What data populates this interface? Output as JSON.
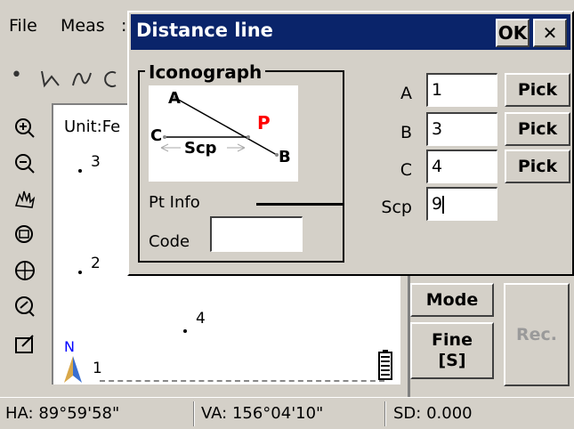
{
  "menubar": {
    "items": [
      "File",
      "Meas",
      ":"
    ]
  },
  "toolbar": {
    "glyphs": [
      "•",
      "⅃ᔑ",
      "ᔑ",
      "ᑕ"
    ]
  },
  "canvas": {
    "unit_label": "Unit:Fe",
    "points": [
      {
        "label": "3"
      },
      {
        "label": "2"
      },
      {
        "label": "4"
      },
      {
        "label": "1"
      }
    ],
    "north_label": "N"
  },
  "side_buttons": {
    "mode": "Mode",
    "fine": "Fine\n[S]",
    "rec": "Rec."
  },
  "status": {
    "ha": "HA:  89°59'58\"",
    "va": "VA: 156°04'10\"",
    "sd": "SD:    0.000"
  },
  "dialog": {
    "title": "Distance line",
    "ok_label": "OK",
    "close_label": "✕",
    "iconograph_legend": "Iconograph",
    "diagram": {
      "a": "A",
      "b": "B",
      "c": "C",
      "p": "P",
      "scp": "Scp"
    },
    "pt_info_legend": "Pt Info",
    "code_label": "Code",
    "code_value": "",
    "fields": [
      {
        "label": "A",
        "value": "1",
        "pick": "Pick"
      },
      {
        "label": "B",
        "value": "3",
        "pick": "Pick"
      },
      {
        "label": "C",
        "value": "4",
        "pick": "Pick"
      },
      {
        "label": "Scp",
        "value": "9"
      }
    ]
  },
  "colors": {
    "title_bg": "#0a246a",
    "accent_p": "#ff0000"
  }
}
